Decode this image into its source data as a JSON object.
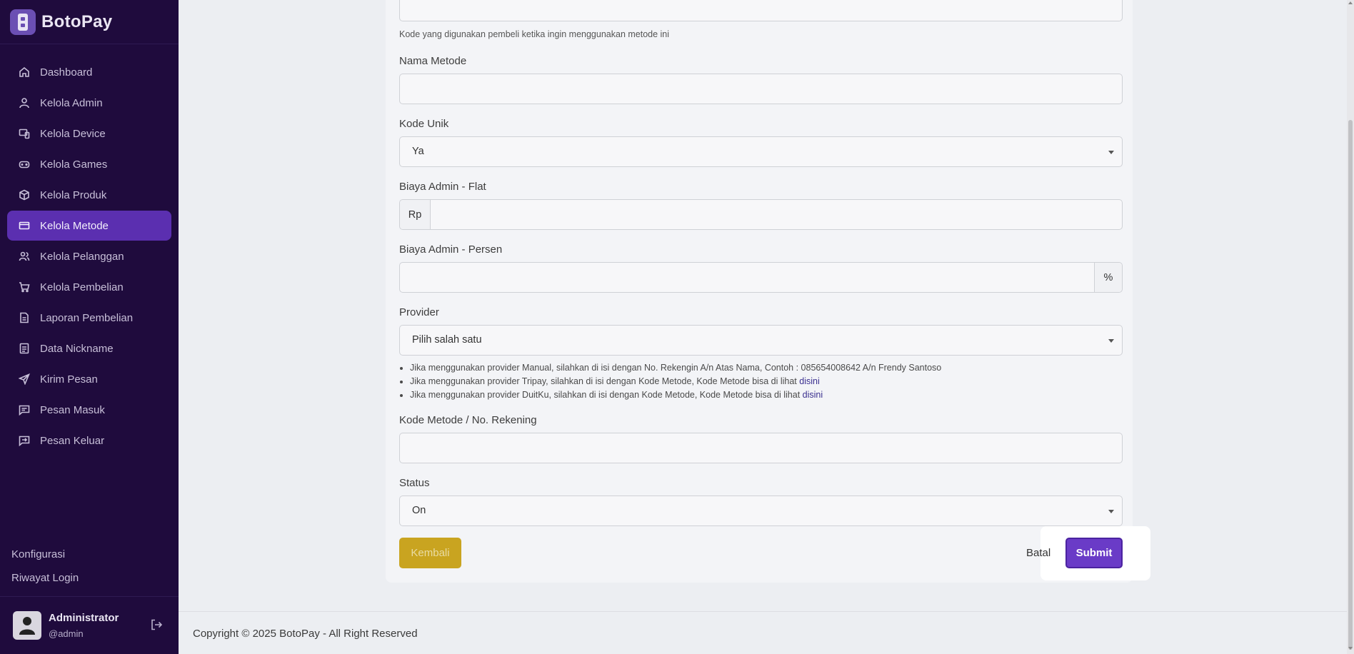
{
  "brand": {
    "name": "BotoPay"
  },
  "sidebar": {
    "items": [
      {
        "label": "Dashboard",
        "icon": "home-icon"
      },
      {
        "label": "Kelola Admin",
        "icon": "user-icon"
      },
      {
        "label": "Kelola Device",
        "icon": "devices-icon"
      },
      {
        "label": "Kelola Games",
        "icon": "gamepad-icon"
      },
      {
        "label": "Kelola Produk",
        "icon": "box-icon"
      },
      {
        "label": "Kelola Metode",
        "icon": "credit-card-icon",
        "active": true
      },
      {
        "label": "Kelola Pelanggan",
        "icon": "users-icon"
      },
      {
        "label": "Kelola Pembelian",
        "icon": "cart-icon"
      },
      {
        "label": "Laporan Pembelian",
        "icon": "file-icon"
      },
      {
        "label": "Data Nickname",
        "icon": "id-card-icon"
      },
      {
        "label": "Kirim Pesan",
        "icon": "send-icon"
      },
      {
        "label": "Pesan Masuk",
        "icon": "message-icon"
      },
      {
        "label": "Pesan Keluar",
        "icon": "message-out-icon"
      }
    ],
    "bottom_links": [
      "Konfigurasi",
      "Riwayat Login"
    ],
    "user": {
      "name": "Administrator",
      "handle": "@admin"
    }
  },
  "form": {
    "kode_help": "Kode yang digunakan pembeli ketika ingin menggunakan metode ini",
    "nama_metode_label": "Nama Metode",
    "kode_unik_label": "Kode Unik",
    "kode_unik_value": "Ya",
    "biaya_flat_label": "Biaya Admin - Flat",
    "biaya_flat_prefix": "Rp",
    "biaya_persen_label": "Biaya Admin - Persen",
    "biaya_persen_suffix": "%",
    "provider_label": "Provider",
    "provider_value": "Pilih salah satu",
    "notes": {
      "n1": "Jika menggunakan provider Manual, silahkan di isi dengan No. Rekengin A/n Atas Nama, Contoh : 085654008642 A/n Frendy Santoso",
      "n2": "Jika menggunakan provider Tripay, silahkan di isi dengan Kode Metode, Kode Metode bisa di lihat ",
      "n2_link": "disini",
      "n3": "Jika menggunakan provider DuitKu, silahkan di isi dengan Kode Metode, Kode Metode bisa di lihat ",
      "n3_link": "disini"
    },
    "kode_rekening_label": "Kode Metode / No. Rekening",
    "status_label": "Status",
    "status_value": "On",
    "kembali_label": "Kembali",
    "batal_label": "Batal",
    "submit_label": "Submit"
  },
  "footer": {
    "text": "Copyright © 2025 BotoPay - All Right Reserved"
  },
  "colors": {
    "sidebar_bg": "#1f0b3d",
    "accent": "#6a3bc7",
    "warning": "#c9a420"
  }
}
